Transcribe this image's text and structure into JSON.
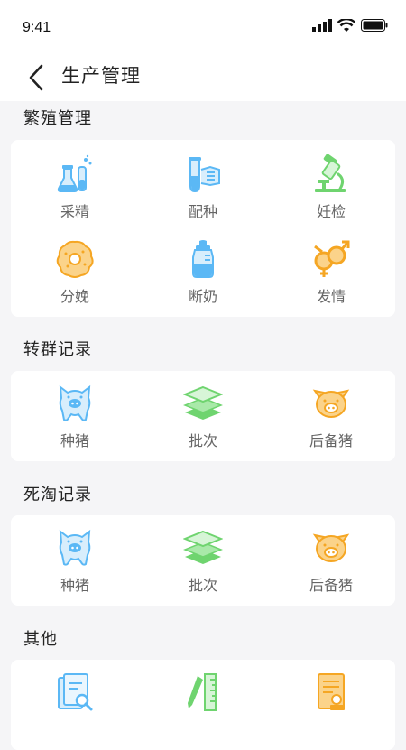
{
  "status": {
    "time": "9:41"
  },
  "header": {
    "title": "生产管理"
  },
  "sections": [
    {
      "title": "繁殖管理",
      "items": [
        {
          "label": "采精",
          "icon": "flask-icon"
        },
        {
          "label": "配种",
          "icon": "test-tube-icon"
        },
        {
          "label": "妊检",
          "icon": "microscope-icon"
        },
        {
          "label": "分娩",
          "icon": "donut-icon"
        },
        {
          "label": "断奶",
          "icon": "baby-bottle-icon"
        },
        {
          "label": "发情",
          "icon": "gender-icon"
        }
      ]
    },
    {
      "title": "转群记录",
      "items": [
        {
          "label": "种猪",
          "icon": "boar-icon"
        },
        {
          "label": "批次",
          "icon": "layers-icon"
        },
        {
          "label": "后备猪",
          "icon": "pig-face-icon"
        }
      ]
    },
    {
      "title": "死淘记录",
      "items": [
        {
          "label": "种猪",
          "icon": "boar-icon"
        },
        {
          "label": "批次",
          "icon": "layers-icon"
        },
        {
          "label": "后备猪",
          "icon": "pig-face-icon"
        }
      ]
    },
    {
      "title": "其他",
      "items": [
        {
          "label": "",
          "icon": "document-search-icon"
        },
        {
          "label": "",
          "icon": "ruler-pencil-icon"
        },
        {
          "label": "",
          "icon": "certificate-icon"
        }
      ]
    }
  ],
  "colors": {
    "blue": "#5bb8f5",
    "green": "#6fd46f",
    "orange": "#f5a623"
  }
}
